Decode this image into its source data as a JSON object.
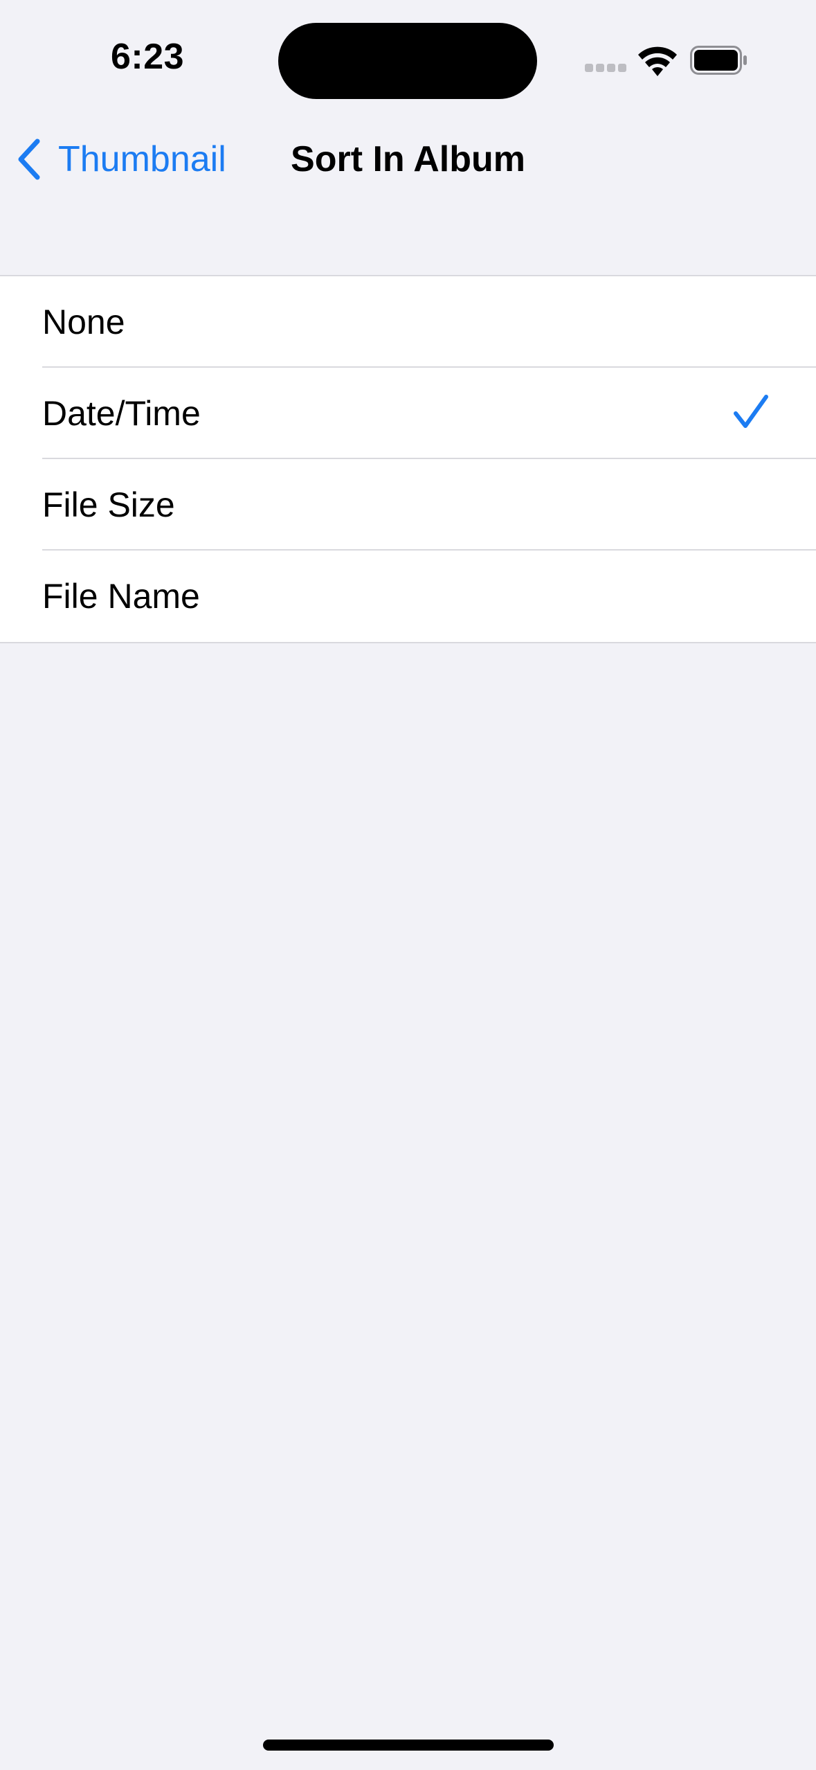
{
  "status_bar": {
    "time": "6:23",
    "icons": [
      "cellular-signal-icon",
      "wifi-icon",
      "battery-icon"
    ]
  },
  "nav": {
    "back_label": "Thumbnail",
    "title": "Sort In Album"
  },
  "options": [
    {
      "label": "None",
      "selected": false
    },
    {
      "label": "Date/Time",
      "selected": true
    },
    {
      "label": "File Size",
      "selected": false
    },
    {
      "label": "File Name",
      "selected": false
    }
  ],
  "colors": {
    "accent": "#1C7CF2",
    "background": "#F2F2F7",
    "cell": "#FFFFFF",
    "separator": "#D9D9DE"
  }
}
